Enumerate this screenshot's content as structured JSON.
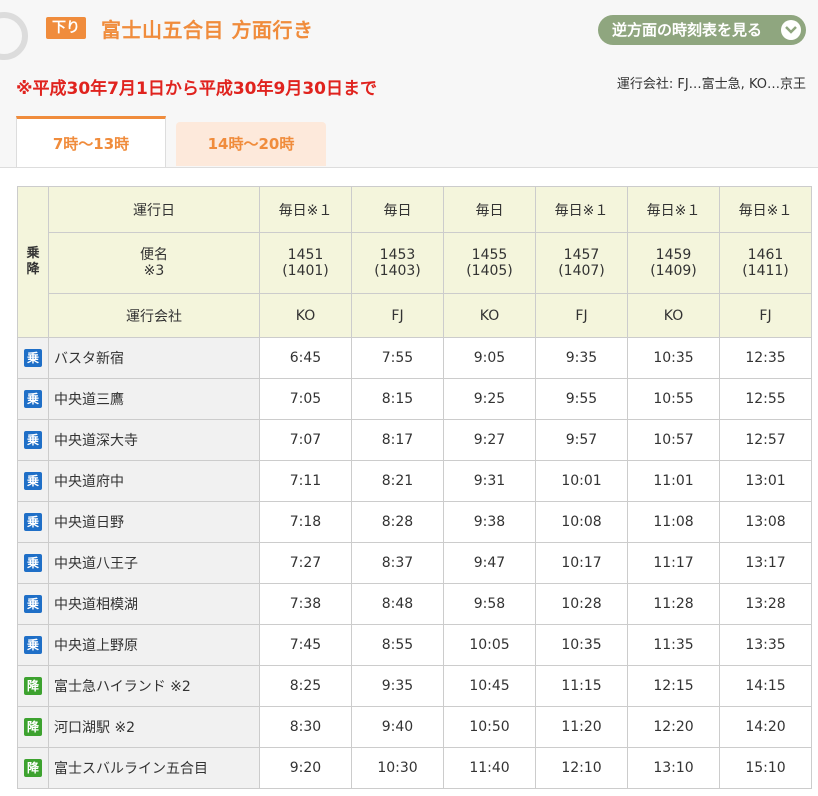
{
  "header": {
    "direction_badge": "下り",
    "title": "富士山五合目 方面行き",
    "reverse_button": "逆方面の時刻表を見る",
    "notice": "※平成30年7月1日から平成30年9月30日まで",
    "operator_note": "運行会社: FJ…富士急, KO…京王"
  },
  "tabs": [
    {
      "label": "7時～13時",
      "active": true
    },
    {
      "label": "14時～20時",
      "active": false
    }
  ],
  "table": {
    "side_label": "乗\n降",
    "row_labels": {
      "days": "運行日",
      "service": "便名",
      "service_note": "※3",
      "company": "運行会社"
    },
    "columns": [
      {
        "days": "毎日※１",
        "service": "1451",
        "service_alt": "(1401)",
        "company": "KO"
      },
      {
        "days": "毎日",
        "service": "1453",
        "service_alt": "(1403)",
        "company": "FJ"
      },
      {
        "days": "毎日",
        "service": "1455",
        "service_alt": "(1405)",
        "company": "KO"
      },
      {
        "days": "毎日※１",
        "service": "1457",
        "service_alt": "(1407)",
        "company": "FJ"
      },
      {
        "days": "毎日※１",
        "service": "1459",
        "service_alt": "(1409)",
        "company": "KO"
      },
      {
        "days": "毎日※１",
        "service": "1461",
        "service_alt": "(1411)",
        "company": "FJ"
      }
    ],
    "icon_labels": {
      "board": "乗",
      "alight": "降"
    },
    "stops": [
      {
        "type": "board",
        "name": "バスタ新宿",
        "times": [
          "6:45",
          "7:55",
          "9:05",
          "9:35",
          "10:35",
          "12:35"
        ]
      },
      {
        "type": "board",
        "name": "中央道三鷹",
        "times": [
          "7:05",
          "8:15",
          "9:25",
          "9:55",
          "10:55",
          "12:55"
        ]
      },
      {
        "type": "board",
        "name": "中央道深大寺",
        "times": [
          "7:07",
          "8:17",
          "9:27",
          "9:57",
          "10:57",
          "12:57"
        ]
      },
      {
        "type": "board",
        "name": "中央道府中",
        "times": [
          "7:11",
          "8:21",
          "9:31",
          "10:01",
          "11:01",
          "13:01"
        ]
      },
      {
        "type": "board",
        "name": "中央道日野",
        "times": [
          "7:18",
          "8:28",
          "9:38",
          "10:08",
          "11:08",
          "13:08"
        ]
      },
      {
        "type": "board",
        "name": "中央道八王子",
        "times": [
          "7:27",
          "8:37",
          "9:47",
          "10:17",
          "11:17",
          "13:17"
        ]
      },
      {
        "type": "board",
        "name": "中央道相模湖",
        "times": [
          "7:38",
          "8:48",
          "9:58",
          "10:28",
          "11:28",
          "13:28"
        ]
      },
      {
        "type": "board",
        "name": "中央道上野原",
        "times": [
          "7:45",
          "8:55",
          "10:05",
          "10:35",
          "11:35",
          "13:35"
        ]
      },
      {
        "type": "alight",
        "name": "富士急ハイランド ※2",
        "times": [
          "8:25",
          "9:35",
          "10:45",
          "11:15",
          "12:15",
          "14:15"
        ]
      },
      {
        "type": "alight",
        "name": "河口湖駅 ※2",
        "times": [
          "8:30",
          "9:40",
          "10:50",
          "11:20",
          "12:20",
          "14:20"
        ]
      },
      {
        "type": "alight",
        "name": "富士スバルライン五合目",
        "times": [
          "9:20",
          "10:30",
          "11:40",
          "12:10",
          "13:10",
          "15:10"
        ]
      }
    ]
  }
}
